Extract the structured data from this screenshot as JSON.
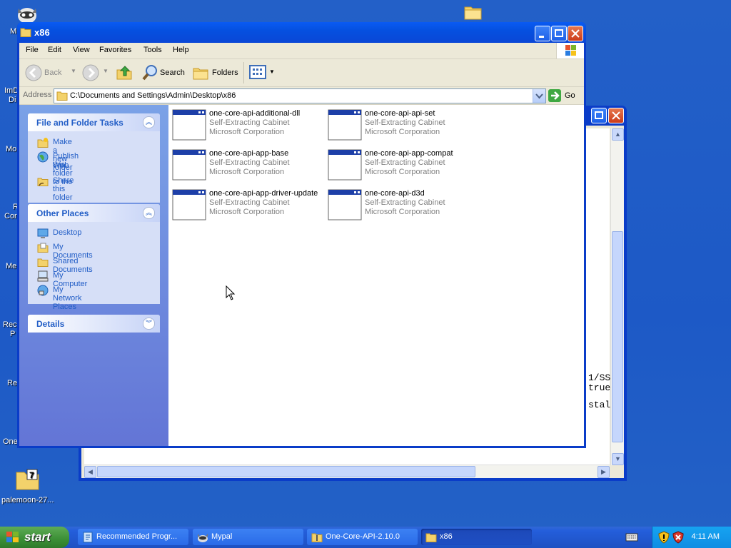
{
  "desktop": {
    "icons": [
      {
        "name": "raccoon-app-icon",
        "label": "M"
      },
      {
        "name": "folder-icon",
        "label": ""
      },
      {
        "name": "desktop-label-imdi",
        "label": "ImD"
      },
      {
        "name": "desktop-label-di",
        "label": "Di"
      },
      {
        "name": "desktop-label-mo",
        "label": "Mo"
      },
      {
        "name": "desktop-label-r",
        "label": "R"
      },
      {
        "name": "desktop-label-cor",
        "label": "Cor"
      },
      {
        "name": "desktop-label-me",
        "label": "Me"
      },
      {
        "name": "desktop-label-rec",
        "label": "Rec"
      },
      {
        "name": "desktop-label-p",
        "label": "P"
      },
      {
        "name": "desktop-label-re",
        "label": "Re"
      },
      {
        "name": "desktop-label-one",
        "label": "One"
      },
      {
        "name": "palemoon-archive",
        "label": "palemoon-27..."
      }
    ]
  },
  "backwindow": {
    "text_lines": [
      "1/SS",
      "true",
      "",
      "stal"
    ]
  },
  "window": {
    "title": "x86",
    "menu": [
      "File",
      "Edit",
      "View",
      "Favorites",
      "Tools",
      "Help"
    ],
    "toolbar": {
      "back": "Back",
      "search": "Search",
      "folders": "Folders"
    },
    "address": {
      "label": "Address",
      "value": "C:\\Documents and Settings\\Admin\\Desktop\\x86",
      "go": "Go"
    },
    "tasks": {
      "file_tasks": {
        "title": "File and Folder Tasks",
        "links": [
          "Make a new folder",
          "Publish this folder to the",
          "Web",
          "Share this folder"
        ]
      },
      "other_places": {
        "title": "Other Places",
        "links": [
          "Desktop",
          "My Documents",
          "Shared Documents",
          "My Computer",
          "My Network Places"
        ]
      },
      "details": {
        "title": "Details"
      }
    },
    "files": [
      {
        "name": "one-core-api-additional-dll",
        "type": "Self-Extracting Cabinet",
        "company": "Microsoft Corporation"
      },
      {
        "name": "one-core-api-api-set",
        "type": "Self-Extracting Cabinet",
        "company": "Microsoft Corporation"
      },
      {
        "name": "one-core-api-app-base",
        "type": "Self-Extracting Cabinet",
        "company": "Microsoft Corporation"
      },
      {
        "name": "one-core-api-app-compat",
        "type": "Self-Extracting Cabinet",
        "company": "Microsoft Corporation"
      },
      {
        "name": "one-core-api-app-driver-update",
        "type": "Self-Extracting Cabinet",
        "company": "Microsoft Corporation"
      },
      {
        "name": "one-core-api-d3d",
        "type": "Self-Extracting Cabinet",
        "company": "Microsoft Corporation"
      }
    ]
  },
  "taskbar": {
    "start": "start",
    "items": [
      {
        "label": "Recommended Progr...",
        "icon": "installer-icon",
        "active": false
      },
      {
        "label": "Mypal",
        "icon": "mypal-icon",
        "active": false
      },
      {
        "label": "One-Core-API-2.10.0",
        "icon": "zip-folder-icon",
        "active": false
      },
      {
        "label": "x86",
        "icon": "folder-icon",
        "active": true
      }
    ],
    "clock": "4:11 AM"
  }
}
